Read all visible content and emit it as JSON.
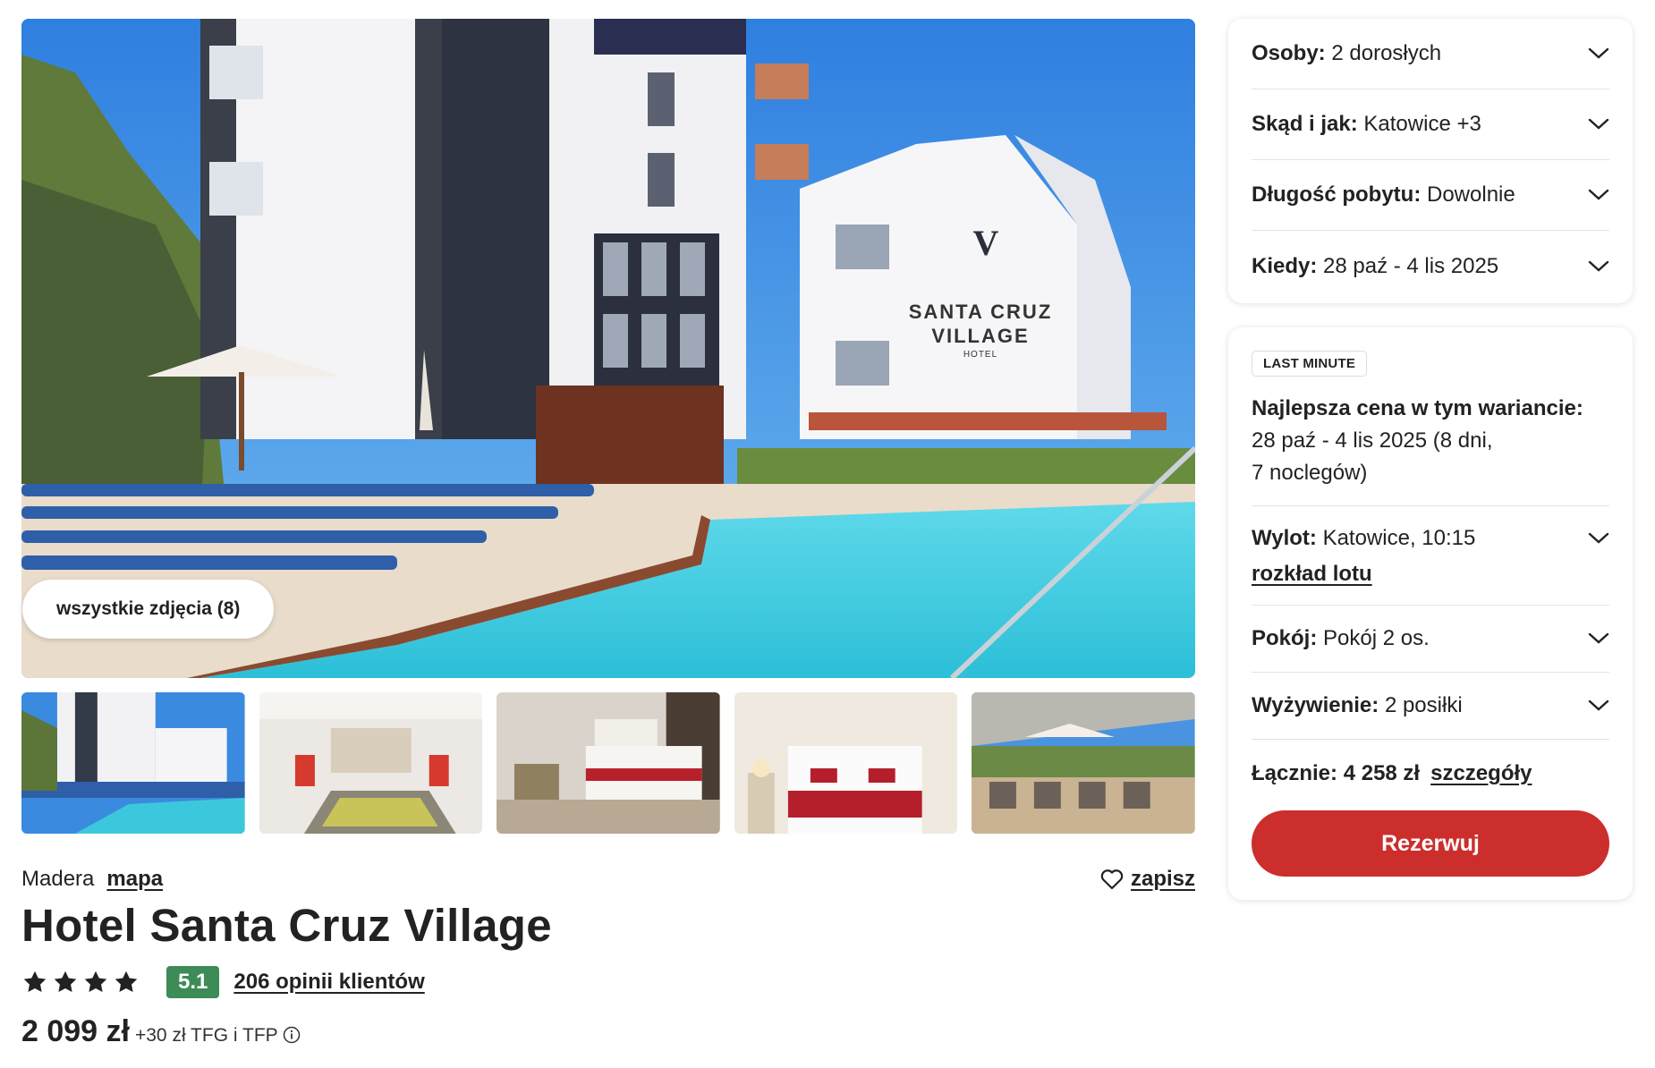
{
  "gallery": {
    "all_photos_label": "wszystkie zdjęcia (8)",
    "main_image": "hotel-pool-exterior",
    "sign_line1": "SANTA CRUZ",
    "sign_line2": "VILLAGE",
    "sign_line3": "HOTEL",
    "sign_logo": "V",
    "thumbnails": [
      "hotel-pool-exterior",
      "lobby-with-pool",
      "double-room",
      "twin-room",
      "terrace-restaurant"
    ]
  },
  "hotel": {
    "region": "Madera",
    "map_label": "mapa",
    "save_label": "zapisz",
    "name": "Hotel Santa Cruz Village",
    "stars": 4,
    "score": "5.1",
    "reviews_label": "206 opinii klientów",
    "price": "2 099 zł",
    "price_extra": "+30 zł TFG i TFP"
  },
  "search": {
    "persons_label": "Osoby:",
    "persons_value": "2 dorosłych",
    "from_label": "Skąd i jak:",
    "from_value": "Katowice +3",
    "length_label": "Długość pobytu:",
    "length_value": "Dowolnie",
    "when_label": "Kiedy:",
    "when_value": "28 paź - 4 lis 2025"
  },
  "offer": {
    "badge": "LAST MINUTE",
    "best_title": "Najlepsza cena w tym wariancie:",
    "best_dates_line1": "28 paź - 4 lis 2025 (8 dni,",
    "best_dates_line2": "7 noclegów)",
    "flight_label": "Wylot:",
    "flight_value": "Katowice, 10:15",
    "flight_schedule_label": "rozkład lotu",
    "room_label": "Pokój:",
    "room_value": "Pokój 2 os.",
    "board_label": "Wyżywienie:",
    "board_value": "2 posiłki",
    "total_label": "Łącznie:",
    "total_value": "4 258 zł",
    "details_label": "szczegóły",
    "book_label": "Rezerwuj"
  },
  "colors": {
    "accent_red": "#cc2e2c",
    "score_green": "#3d8b57",
    "text": "#222222",
    "pool": "#35c6dc",
    "sky": "#3c8be2"
  },
  "icons": [
    "heart-icon",
    "star-icon",
    "info-icon",
    "chevron-down-icon"
  ]
}
